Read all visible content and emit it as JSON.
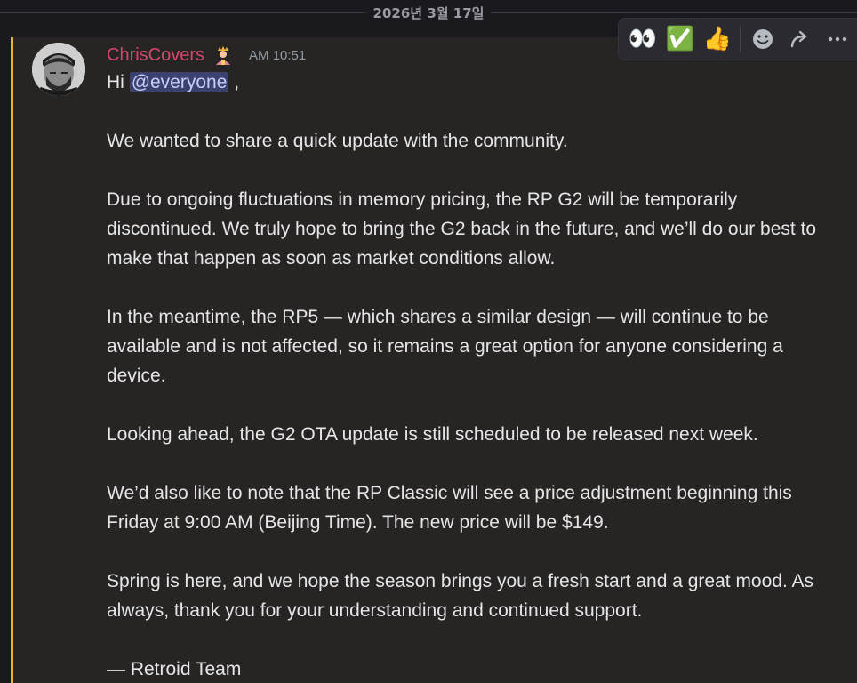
{
  "date_divider": "2026년 3월 17일",
  "message": {
    "author": "ChrisCovers",
    "role_icon": "crowned-person-icon",
    "timestamp": "AM 10:51",
    "greeting_prefix": "Hi",
    "mention": "@everyone",
    "greeting_suffix": ",",
    "paragraphs": [
      "We wanted to share a quick update with the community.",
      "Due to ongoing fluctuations in memory pricing, the RP G2 will be temporarily discontinued. We truly hope to bring the G2 back in the future, and we’ll do our best to make that happen as soon as market conditions allow.",
      "In the meantime, the RP5 — which shares a similar design — will continue to be available and is not affected, so it remains a great option for anyone considering a device.",
      "Looking ahead, the G2 OTA update is still scheduled to be released next week.",
      "We’d also like to note that the RP Classic will see a price adjustment beginning this Friday at 9:00 AM (Beijing Time). The new price will be $149.",
      "Spring is here, and we hope the season brings you a fresh start and a great mood. As always, thank you for your understanding and continued support.",
      "— Retroid Team"
    ]
  },
  "toolbar": {
    "reactions": [
      {
        "emoji": "👀",
        "icon": "eyes-icon"
      },
      {
        "emoji": "✅",
        "icon": "check-mark-icon"
      },
      {
        "emoji": "👍",
        "icon": "thumbs-up-icon"
      }
    ],
    "actions": [
      {
        "icon": "add-reaction-icon"
      },
      {
        "icon": "forward-icon"
      },
      {
        "icon": "more-options-icon"
      }
    ]
  },
  "colors": {
    "author": "#d8476e",
    "highlight_border": "#f0b232",
    "mention_bg": "#3c4270",
    "mention_text": "#c9cdfb"
  }
}
